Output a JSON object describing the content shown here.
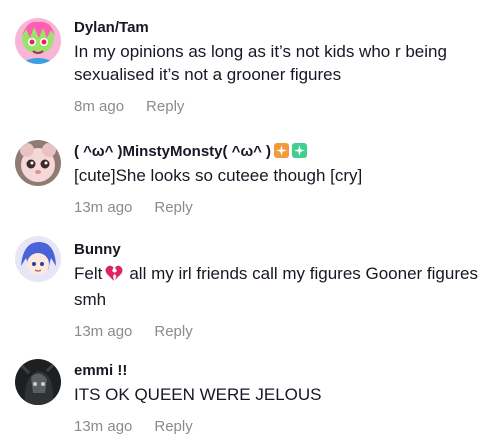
{
  "comments": [
    {
      "username": "Dylan/Tam",
      "text": "In my opinions as long as it’s not kids who r being sexualised it’s not a grooner figures",
      "time": "8m ago",
      "reply": "Reply"
    },
    {
      "username": "( ^ω^ )MinstyMonsty( ^ω^ )",
      "username_emojis": [
        "sparkle-orange-icon",
        "sparkle-green-icon"
      ],
      "text": "[cute]She looks so cuteee though [cry]",
      "time": "13m ago",
      "reply": "Reply"
    },
    {
      "username": "Bunny",
      "text_before": "Felt",
      "text_emoji": "broken-heart-icon",
      "text_after": "all my irl friends call my figures Gooner figures smh",
      "time": "13m ago",
      "reply": "Reply"
    },
    {
      "username": "emmi !!",
      "text": "ITS OK QUEEN WERE JELOUS",
      "time": "13m ago",
      "reply": "Reply"
    }
  ],
  "colors": {
    "text": "#161823",
    "meta": "#8a8b91",
    "heart": "#e0245e",
    "emoji_orange": "#f39a3c",
    "emoji_green": "#3fcf8e"
  }
}
